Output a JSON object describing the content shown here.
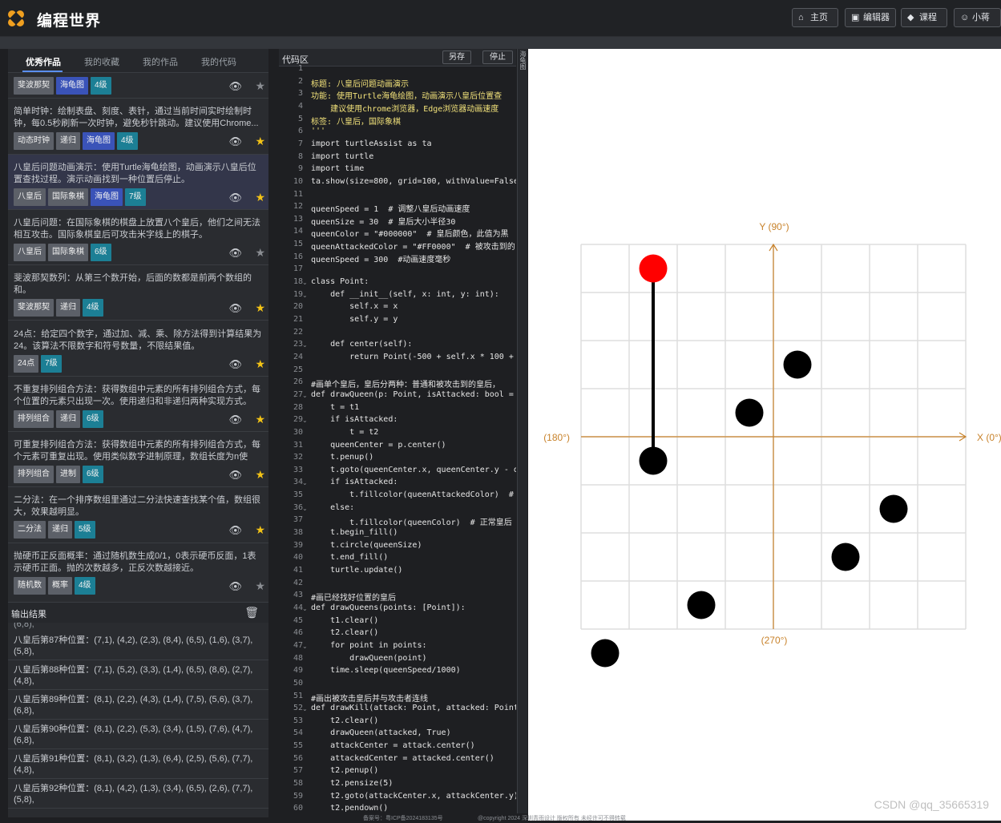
{
  "app": {
    "title": "编程世界"
  },
  "nav": [
    {
      "label": "主页",
      "icon": "home-icon",
      "glyph": "⌂"
    },
    {
      "label": "编辑器",
      "icon": "editor-icon",
      "glyph": "▣"
    },
    {
      "label": "课程",
      "icon": "course-icon",
      "glyph": "◆"
    },
    {
      "label": "小蒋",
      "icon": "user-icon",
      "glyph": "☺"
    }
  ],
  "tabs": [
    "优秀作品",
    "我的收藏",
    "我的作品",
    "我的代码"
  ],
  "works": [
    {
      "desc": "",
      "tags": [
        {
          "t": "斐波那契",
          "c": "gray"
        },
        {
          "t": "海龟图",
          "c": "blue"
        },
        {
          "t": "4级",
          "c": "teal"
        }
      ],
      "star": false
    },
    {
      "desc": "简单时钟：绘制表盘、刻度、表针，通过当前时间实时绘制时钟，每0.5秒刷新一次时钟，避免秒针跳动。建议使用Chrome...",
      "tags": [
        {
          "t": "动态时钟",
          "c": "gray"
        },
        {
          "t": "递归",
          "c": "gray"
        },
        {
          "t": "海龟图",
          "c": "blue"
        },
        {
          "t": "4级",
          "c": "teal"
        }
      ],
      "star": true
    },
    {
      "desc": "八皇后问题动画演示：使用Turtle海龟绘图，动画演示八皇后位置查找过程。演示动画找到一种位置后停止。",
      "tags": [
        {
          "t": "八皇后",
          "c": "gray"
        },
        {
          "t": "国际象棋",
          "c": "gray"
        },
        {
          "t": "海龟图",
          "c": "blue"
        },
        {
          "t": "7级",
          "c": "teal"
        }
      ],
      "star": true
    },
    {
      "desc": "八皇后问题：在国际象棋的棋盘上放置八个皇后，他们之间无法相互攻击。国际象棋皇后可攻击米字线上的棋子。",
      "tags": [
        {
          "t": "八皇后",
          "c": "gray"
        },
        {
          "t": "国际象棋",
          "c": "gray"
        },
        {
          "t": "6级",
          "c": "teal"
        }
      ],
      "star": false
    },
    {
      "desc": "斐波那契数列：从第三个数开始，后面的数都是前两个数组的和。",
      "tags": [
        {
          "t": "斐波那契",
          "c": "gray"
        },
        {
          "t": "递归",
          "c": "gray"
        },
        {
          "t": "4级",
          "c": "teal"
        }
      ],
      "star": true
    },
    {
      "desc": "24点：给定四个数字，通过加、减、乘、除方法得到计算结果为24。该算法不限数字和符号数量，不限结果值。",
      "tags": [
        {
          "t": "24点",
          "c": "gray"
        },
        {
          "t": "7级",
          "c": "teal"
        }
      ],
      "star": true
    },
    {
      "desc": "不重复排列组合方法：获得数组中元素的所有排列组合方式，每个位置的元素只出现一次。使用递归和非递归两种实现方式。",
      "tags": [
        {
          "t": "排列组合",
          "c": "gray"
        },
        {
          "t": "递归",
          "c": "gray"
        },
        {
          "t": "6级",
          "c": "teal"
        }
      ],
      "star": true
    },
    {
      "desc": "可重复排列组合方法：获得数组中元素的所有排列组合方式，每个元素可重复出现。使用类似数字进制原理，数组长度为n使用...",
      "tags": [
        {
          "t": "排列组合",
          "c": "gray"
        },
        {
          "t": "进制",
          "c": "gray"
        },
        {
          "t": "6级",
          "c": "teal"
        }
      ],
      "star": true
    },
    {
      "desc": "二分法：在一个排序数组里通过二分法快速查找某个值，数组很大，效果越明显。",
      "tags": [
        {
          "t": "二分法",
          "c": "gray"
        },
        {
          "t": "递归",
          "c": "gray"
        },
        {
          "t": "5级",
          "c": "teal"
        }
      ],
      "star": true
    },
    {
      "desc": "抛硬币正反面概率：通过随机数生成0/1，0表示硬币反面，1表示硬币正面。抛的次数越多，正反次数越接近。",
      "tags": [
        {
          "t": "随机数",
          "c": "gray"
        },
        {
          "t": "概率",
          "c": "gray"
        },
        {
          "t": "4级",
          "c": "teal"
        }
      ],
      "star": false
    }
  ],
  "output": {
    "title": "输出结果",
    "partial": "(6,8),",
    "items": [
      "八皇后第87种位置：(7,1), (4,2), (2,3), (8,4), (6,5), (1,6), (3,7), (5,8),",
      "八皇后第88种位置：(7,1), (5,2), (3,3), (1,4), (6,5), (8,6), (2,7), (4,8),",
      "八皇后第89种位置：(8,1), (2,2), (4,3), (1,4), (7,5), (5,6), (3,7), (6,8),",
      "八皇后第90种位置：(8,1), (2,2), (5,3), (3,4), (1,5), (7,6), (4,7), (6,8),",
      "八皇后第91种位置：(8,1), (3,2), (1,3), (6,4), (2,5), (5,6), (7,7), (4,8),",
      "八皇后第92种位置：(8,1), (4,2), (1,3), (3,4), (6,5), (2,6), (7,7), (5,8),"
    ]
  },
  "code": {
    "title": "代码区",
    "save_label": "另存",
    "stop_label": "停止",
    "side_label": "海龟图",
    "lines": [
      {
        "n": 1,
        "t": "'''",
        "c": "str"
      },
      {
        "n": 2,
        "t": "标题: 八皇后问题动画演示",
        "c": "str"
      },
      {
        "n": 3,
        "t": "功能: 使用Turtle海龟绘图，动画演示八皇后位置查",
        "c": "str"
      },
      {
        "n": 4,
        "t": "    建议使用chrome浏览器，Edge浏览器动画速度",
        "c": "str"
      },
      {
        "n": 5,
        "t": "标签: 八皇后，国际象棋",
        "c": "str"
      },
      {
        "n": 6,
        "t": "'''",
        "c": "str"
      },
      {
        "n": 7,
        "t": "import turtleAssist as ta",
        "c": "kw"
      },
      {
        "n": 8,
        "t": "import turtle",
        "c": "kw"
      },
      {
        "n": 9,
        "t": "import time",
        "c": "kw"
      },
      {
        "n": 10,
        "t": "ta.show(size=800, grid=100, withValue=False",
        "c": "kw"
      },
      {
        "n": 11,
        "t": "",
        "c": "kw"
      },
      {
        "n": 12,
        "t": "queenSpeed = 1  # 调整八皇后动画速度",
        "c": "kw"
      },
      {
        "n": 13,
        "t": "queenSize = 30  # 皇后大小半径30",
        "c": "kw"
      },
      {
        "n": 14,
        "t": "queenColor = \"#000000\"  # 皇后颜色，此值为黑",
        "c": "kw"
      },
      {
        "n": 15,
        "t": "queenAttackedColor = \"#FF0000\"  # 被攻击到的",
        "c": "kw"
      },
      {
        "n": 16,
        "t": "queenSpeed = 300  #动画速度毫秒",
        "c": "kw"
      },
      {
        "n": 17,
        "t": "",
        "c": "kw"
      },
      {
        "n": 18,
        "t": "class Point:",
        "c": "kw",
        "f": true
      },
      {
        "n": 19,
        "t": "    def __init__(self, x: int, y: int):",
        "c": "kw",
        "f": true
      },
      {
        "n": 20,
        "t": "        self.x = x",
        "c": "kw"
      },
      {
        "n": 21,
        "t": "        self.y = y",
        "c": "kw"
      },
      {
        "n": 22,
        "t": "",
        "c": "kw"
      },
      {
        "n": 23,
        "t": "    def center(self):",
        "c": "kw",
        "f": true
      },
      {
        "n": 24,
        "t": "        return Point(-500 + self.x * 100 +",
        "c": "kw"
      },
      {
        "n": 25,
        "t": "",
        "c": "kw"
      },
      {
        "n": 26,
        "t": "#画单个皇后，皇后分两种：普通和被攻击到的皇后，",
        "c": "kw"
      },
      {
        "n": 27,
        "t": "def drawQueen(p: Point, isAttacked: bool =",
        "c": "kw",
        "f": true
      },
      {
        "n": 28,
        "t": "    t = t1",
        "c": "kw"
      },
      {
        "n": 29,
        "t": "    if isAttacked:",
        "c": "kw",
        "f": true
      },
      {
        "n": 30,
        "t": "        t = t2",
        "c": "kw"
      },
      {
        "n": 31,
        "t": "    queenCenter = p.center()",
        "c": "kw"
      },
      {
        "n": 32,
        "t": "    t.penup()",
        "c": "kw"
      },
      {
        "n": 33,
        "t": "    t.goto(queenCenter.x, queenCenter.y - q",
        "c": "kw"
      },
      {
        "n": 34,
        "t": "    if isAttacked:",
        "c": "kw",
        "f": true
      },
      {
        "n": 35,
        "t": "        t.fillcolor(queenAttackedColor)  #",
        "c": "kw"
      },
      {
        "n": 36,
        "t": "    else:",
        "c": "kw",
        "f": true
      },
      {
        "n": 37,
        "t": "        t.fillcolor(queenColor)  # 正常皇后",
        "c": "kw"
      },
      {
        "n": 38,
        "t": "    t.begin_fill()",
        "c": "kw"
      },
      {
        "n": 39,
        "t": "    t.circle(queenSize)",
        "c": "kw"
      },
      {
        "n": 40,
        "t": "    t.end_fill()",
        "c": "kw"
      },
      {
        "n": 41,
        "t": "    turtle.update()",
        "c": "kw"
      },
      {
        "n": 42,
        "t": "",
        "c": "kw"
      },
      {
        "n": 43,
        "t": "#画已经找好位置的皇后",
        "c": "kw"
      },
      {
        "n": 44,
        "t": "def drawQueens(points: [Point]):",
        "c": "kw",
        "f": true
      },
      {
        "n": 45,
        "t": "    t1.clear()",
        "c": "kw"
      },
      {
        "n": 46,
        "t": "    t2.clear()",
        "c": "kw"
      },
      {
        "n": 47,
        "t": "    for point in points:",
        "c": "kw",
        "f": true
      },
      {
        "n": 48,
        "t": "        drawQueen(point)",
        "c": "kw"
      },
      {
        "n": 49,
        "t": "    time.sleep(queenSpeed/1000)",
        "c": "kw"
      },
      {
        "n": 50,
        "t": "",
        "c": "kw"
      },
      {
        "n": 51,
        "t": "#画出被攻击皇后并与攻击者连线",
        "c": "kw"
      },
      {
        "n": 52,
        "t": "def drawKill(attack: Point, attacked: Point",
        "c": "kw",
        "f": true
      },
      {
        "n": 53,
        "t": "    t2.clear()",
        "c": "kw"
      },
      {
        "n": 54,
        "t": "    drawQueen(attacked, True)",
        "c": "kw"
      },
      {
        "n": 55,
        "t": "    attackCenter = attack.center()",
        "c": "kw"
      },
      {
        "n": 56,
        "t": "    attackedCenter = attacked.center()",
        "c": "kw"
      },
      {
        "n": 57,
        "t": "    t2.penup()",
        "c": "kw"
      },
      {
        "n": 58,
        "t": "    t2.pensize(5)",
        "c": "kw"
      },
      {
        "n": 59,
        "t": "    t2.goto(attackCenter.x, attackCenter.y)",
        "c": "kw"
      },
      {
        "n": 60,
        "t": "    t2.pendown()",
        "c": "kw"
      }
    ]
  },
  "board": {
    "axis_y": "Y (90°)",
    "axis_x": "X (0°)",
    "axis_left": "(180°)",
    "axis_bottom": "(270°)",
    "queens": [
      [
        2,
        1
      ],
      [
        5,
        3
      ],
      [
        4,
        4
      ],
      [
        2,
        5
      ],
      [
        7,
        6
      ],
      [
        6,
        7
      ],
      [
        3,
        8
      ],
      [
        1,
        9
      ]
    ],
    "attacked": [
      2,
      1
    ],
    "link": [
      [
        2,
        1
      ],
      [
        2,
        5
      ]
    ],
    "axis_color": "#c8822a"
  },
  "footer": {
    "left": "备案号：粤ICP备2024183135号",
    "right": "@copyright 2024 深圳青雨设计 版权所有 未经许可不得转载"
  },
  "watermark": "CSDN @qq_35665319"
}
